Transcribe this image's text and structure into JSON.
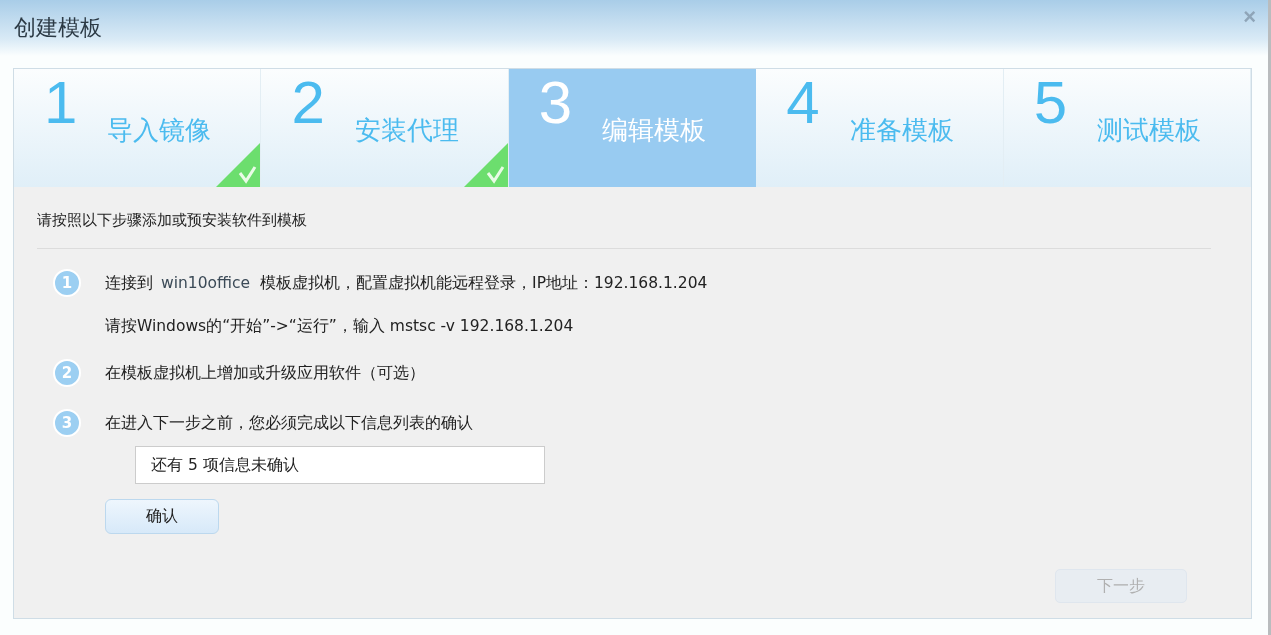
{
  "window": {
    "title": "创建模板",
    "close": "×"
  },
  "steps": [
    {
      "number": "1",
      "label": "导入镜像",
      "selected": false,
      "done": true
    },
    {
      "number": "2",
      "label": "安装代理",
      "selected": false,
      "done": true
    },
    {
      "number": "3",
      "label": "编辑模板",
      "selected": true,
      "done": false
    },
    {
      "number": "4",
      "label": "准备模板",
      "selected": false,
      "done": false
    },
    {
      "number": "5",
      "label": "测试模板",
      "selected": false,
      "done": false
    }
  ],
  "heading": "请按照以下步骤添加或预安装软件到模板",
  "instructions": [
    {
      "number": "1",
      "before": "连接到",
      "name": "win10office",
      "after": "模板虚拟机，配置虚拟机能远程登录，IP地址：192.168.1.204",
      "note": "请按Windows的“开始”->“运行”，输入 mstsc -v 192.168.1.204"
    },
    {
      "number": "2",
      "text": "在模板虚拟机上增加或升级应用软件（可选）"
    },
    {
      "number": "3",
      "text": "在进入下一步之前，您必须完成以下信息列表的确认",
      "field_value": "还有 5 项信息未确认",
      "button": "确认"
    }
  ],
  "next_button": {
    "label": "下一步",
    "disabled": true
  }
}
